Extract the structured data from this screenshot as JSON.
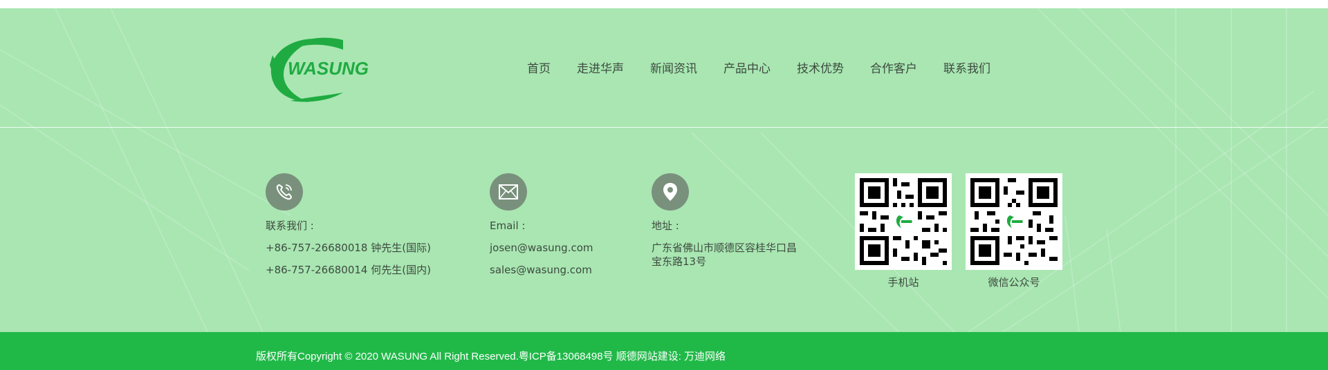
{
  "colors": {
    "footer_bg": "#a9e6b2",
    "bottom_bar": "#20b948",
    "brand_green": "#1fab41",
    "icon_circle": "#79917c",
    "text": "#3d4a3f"
  },
  "logo": {
    "text": "WASUNG",
    "icon": "wasung-logo-icon"
  },
  "nav": {
    "items": [
      {
        "label": "首页"
      },
      {
        "label": "走进华声"
      },
      {
        "label": "新闻资讯"
      },
      {
        "label": "产品中心"
      },
      {
        "label": "技术优势"
      },
      {
        "label": "合作客户"
      },
      {
        "label": "联系我们"
      }
    ]
  },
  "contact": {
    "phone": {
      "icon": "phone-icon",
      "label": "联系我们 :",
      "lines": [
        "+86-757-26680018 钟先生(国际)",
        "+86-757-26680014 何先生(国内)"
      ]
    },
    "email": {
      "icon": "mail-icon",
      "label": "Email :",
      "lines": [
        "josen@wasung.com",
        "sales@wasung.com"
      ]
    },
    "address": {
      "icon": "location-icon",
      "label": "地址 :",
      "text": "广东省佛山市顺德区容桂华口昌宝东路13号"
    }
  },
  "qr": [
    {
      "caption": "手机站",
      "icon": "qr-code-icon"
    },
    {
      "caption": "微信公众号",
      "icon": "qr-code-icon"
    }
  ],
  "bottom": {
    "copyright": "版权所有Copyright © 2020 WASUNG All Right Reserved.粤ICP备13068498号    顺德网站建设:   万迪网络"
  }
}
